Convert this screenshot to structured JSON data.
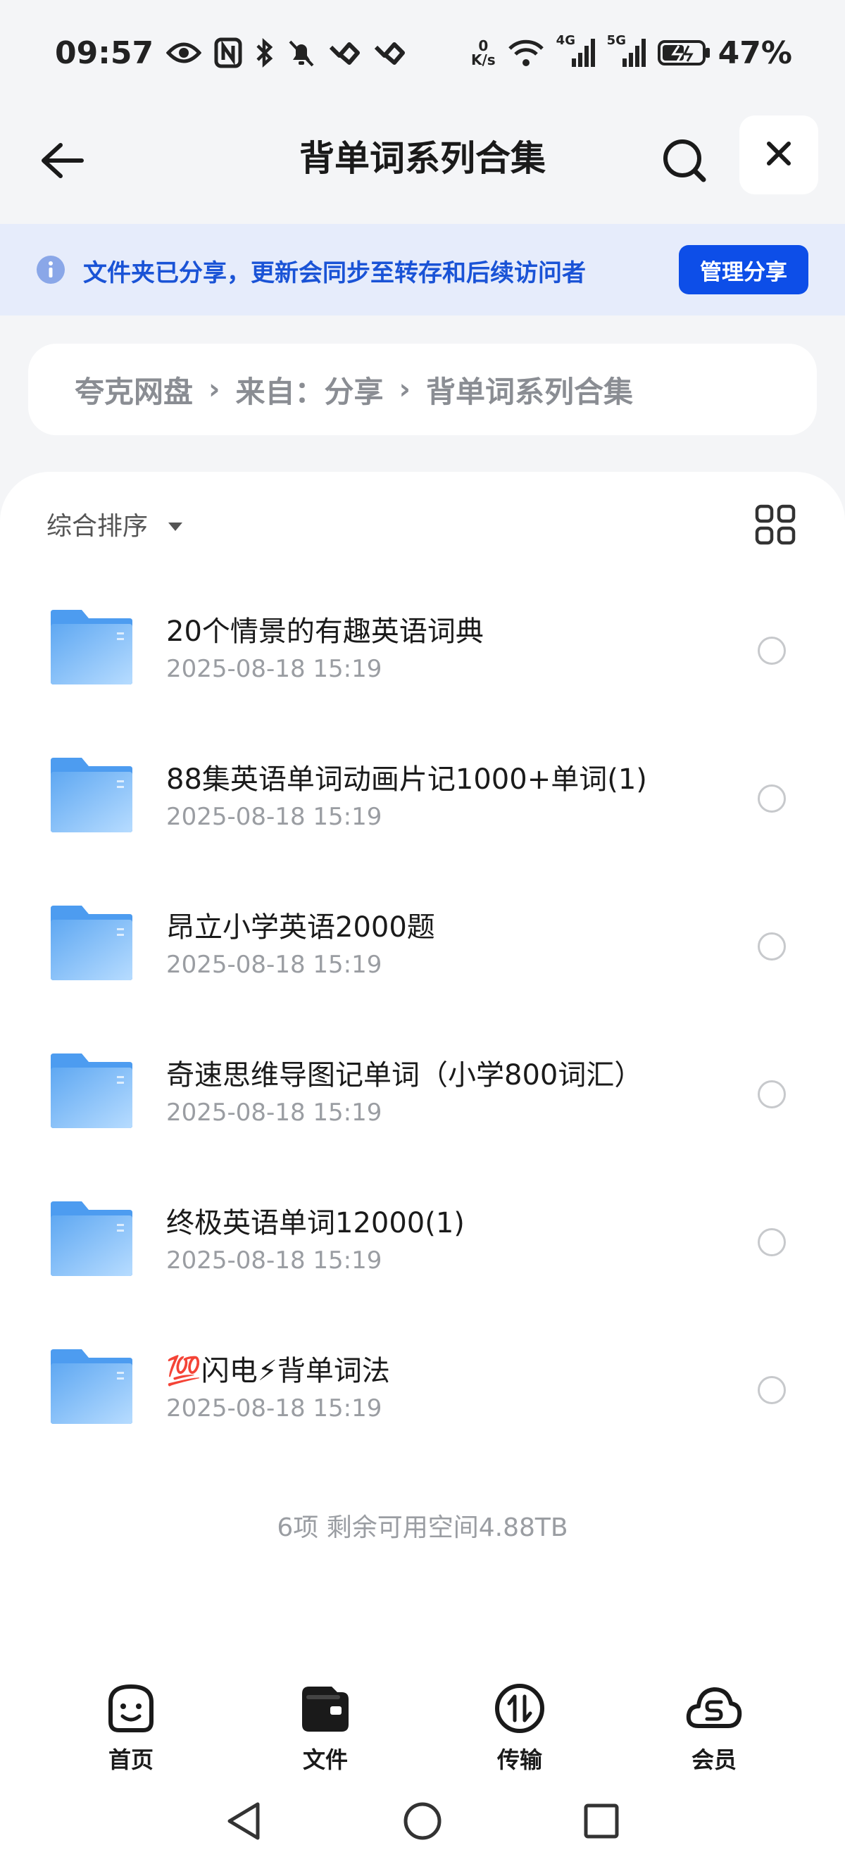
{
  "status_bar": {
    "time": "09:57",
    "net_speed_value": "0",
    "net_speed_unit": "K/s",
    "signal_1_label": "4G",
    "signal_2_label": "5G",
    "battery": "47%"
  },
  "header": {
    "title": "背单词系列合集"
  },
  "banner": {
    "message": "文件夹已分享，更新会同步至转存和后续访问者",
    "manage_label": "管理分享"
  },
  "breadcrumb": {
    "items": [
      "夸克网盘",
      "来自：分享",
      "背单词系列合集"
    ]
  },
  "sort": {
    "label": "综合排序"
  },
  "files": [
    {
      "name": "20个情景的有趣英语词典",
      "date": "2025-08-18 15:19"
    },
    {
      "name": "88集英语单词动画片记1000+单词(1)",
      "date": "2025-08-18 15:19"
    },
    {
      "name": "昂立小学英语2000题",
      "date": "2025-08-18 15:19"
    },
    {
      "name": "奇速思维导图记单词（小学800词汇）",
      "date": "2025-08-18 15:19"
    },
    {
      "name": "终极英语单词12000(1)",
      "date": "2025-08-18 15:19"
    },
    {
      "name": "💯闪电⚡背单词法",
      "date": "2025-08-18 15:19"
    }
  ],
  "footer_info": "6项 剩余可用空间4.88TB",
  "bottom_nav": {
    "items": [
      {
        "label": "首页",
        "icon": "smile-face-icon"
      },
      {
        "label": "文件",
        "icon": "folder-wallet-icon"
      },
      {
        "label": "传输",
        "icon": "transfer-arrows-icon"
      },
      {
        "label": "会员",
        "icon": "cloud-s-icon"
      }
    ]
  },
  "colors": {
    "accent": "#0d4ee8",
    "banner_bg": "#e6ecfb",
    "banner_text": "#1a53d6",
    "folder": "#6fb3f5"
  }
}
